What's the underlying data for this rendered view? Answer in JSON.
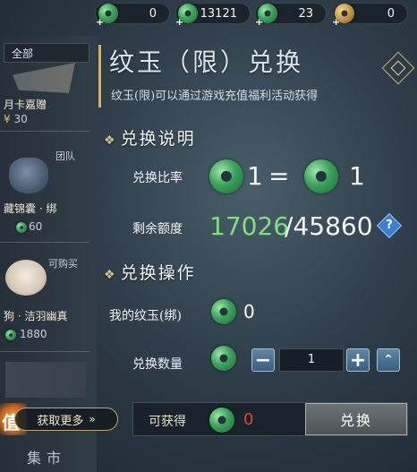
{
  "currency_bar": [
    {
      "value": "0"
    },
    {
      "value": "13121"
    },
    {
      "value": "23"
    },
    {
      "value": "0"
    }
  ],
  "sidebar": {
    "filter": "全部",
    "items": [
      {
        "title": "月卡嘉赠",
        "price": "30",
        "currency_symbol": "¥",
        "tag": ""
      },
      {
        "title": "藏锦囊 · 绑",
        "price": "60",
        "tag": "团队"
      },
      {
        "title": "狗 · 洁羽幽真",
        "price": "1880",
        "tag": "可购买"
      },
      {
        "title": "",
        "price": "",
        "tag": ""
      }
    ],
    "get_more": "获取更多",
    "market": "集市",
    "badge": "值"
  },
  "main": {
    "title": "纹玉（限）兑换",
    "subtitle": "纹玉(限)可以通过游戏充值福利活动获得",
    "section_info": "兑换说明",
    "rate_label": "兑换比率",
    "rate_left": "1",
    "rate_eq": "=",
    "rate_right": "1",
    "remaining_label": "剩余额度",
    "remaining_used": "17026",
    "remaining_total": "/45860",
    "help": "?",
    "section_op": "兑换操作",
    "my_jade_label": "我的纹玉(绑)",
    "my_jade_value": "0",
    "qty_label": "兑换数量",
    "qty_value": "1",
    "minus": "−",
    "plus": "+",
    "max": "⌃",
    "gain_label": "可获得",
    "gain_value": "0",
    "exchange": "兑换"
  },
  "colors": {
    "accent_green": "#7fe07f",
    "gain_red": "#e0443a",
    "gold": "#c9b27a"
  }
}
